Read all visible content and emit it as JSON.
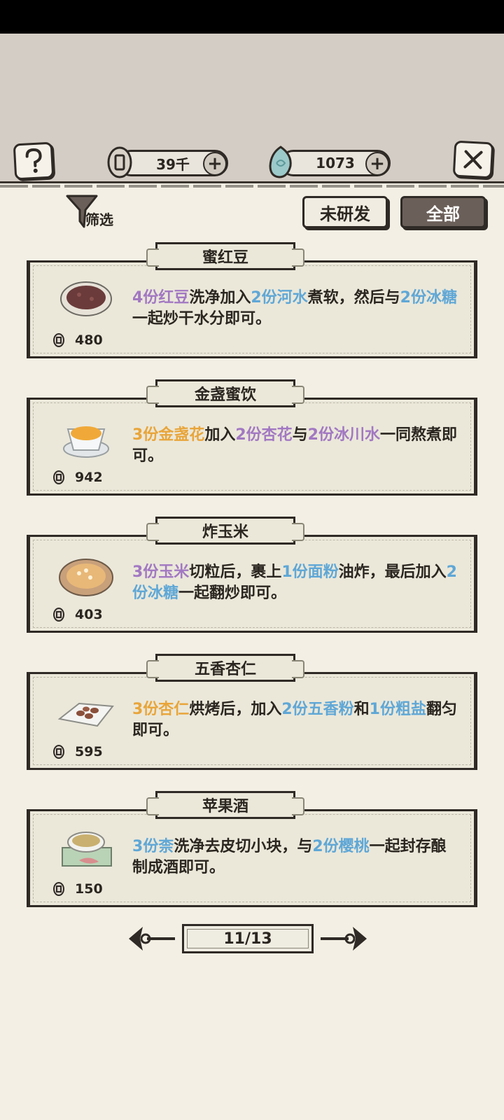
{
  "header": {
    "coins": "39千",
    "gems": "1073",
    "help_icon": "question-icon",
    "close_icon": "close-icon",
    "plus_symbol": "+"
  },
  "filter": {
    "label": "筛选"
  },
  "tabs": [
    {
      "label": "未研发"
    },
    {
      "label": "全部"
    }
  ],
  "recipes": [
    {
      "title": "蜜红豆",
      "price": "480",
      "desc": [
        {
          "t": "4份红豆",
          "c": "purple"
        },
        {
          "t": "洗净加入",
          "c": ""
        },
        {
          "t": "2份河水",
          "c": "blue"
        },
        {
          "t": "煮软，然后与",
          "c": ""
        },
        {
          "t": "2份冰糖",
          "c": "blue"
        },
        {
          "t": "一起炒干水分即可。",
          "c": ""
        }
      ]
    },
    {
      "title": "金盏蜜饮",
      "price": "942",
      "desc": [
        {
          "t": "3份金盏花",
          "c": "orange"
        },
        {
          "t": "加入",
          "c": ""
        },
        {
          "t": "2份杏花",
          "c": "purple"
        },
        {
          "t": "与",
          "c": ""
        },
        {
          "t": "2份冰川水",
          "c": "purple"
        },
        {
          "t": "一同熬煮即可。",
          "c": ""
        }
      ]
    },
    {
      "title": "炸玉米",
      "price": "403",
      "desc": [
        {
          "t": "3份玉米",
          "c": "purple"
        },
        {
          "t": "切粒后，裹上",
          "c": ""
        },
        {
          "t": "1份面粉",
          "c": "blue"
        },
        {
          "t": "油炸，最后加入",
          "c": ""
        },
        {
          "t": "2份冰糖",
          "c": "blue"
        },
        {
          "t": "一起翻炒即可。",
          "c": ""
        }
      ]
    },
    {
      "title": "五香杏仁",
      "price": "595",
      "desc": [
        {
          "t": "3份杏仁",
          "c": "orange"
        },
        {
          "t": "烘烤后，加入",
          "c": ""
        },
        {
          "t": "2份五香粉",
          "c": "blue"
        },
        {
          "t": "和",
          "c": ""
        },
        {
          "t": "1份粗盐",
          "c": "blue"
        },
        {
          "t": "翻匀即可。",
          "c": ""
        }
      ]
    },
    {
      "title": "苹果酒",
      "price": "150",
      "desc": [
        {
          "t": "3份柰",
          "c": "blue"
        },
        {
          "t": "洗净去皮切小块，与",
          "c": ""
        },
        {
          "t": "2份樱桃",
          "c": "blue"
        },
        {
          "t": "一起封存酿制成酒即可。",
          "c": ""
        }
      ]
    }
  ],
  "pager": {
    "label": "11/13"
  }
}
